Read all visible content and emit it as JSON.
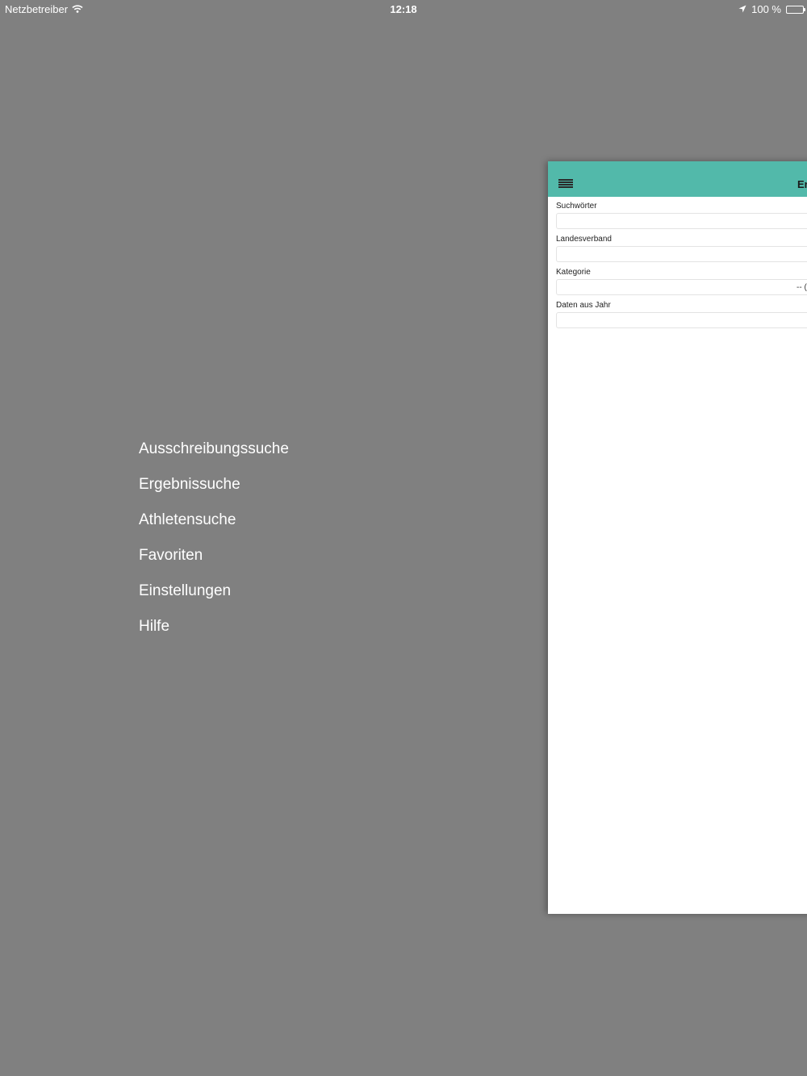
{
  "status_bar": {
    "carrier": "Netzbetreiber",
    "wifi_icon": "wifi-icon",
    "time": "12:18",
    "location_icon": "location-arrow-icon",
    "battery_text": "100 %",
    "battery_level": 1.0
  },
  "side_menu": {
    "items": [
      {
        "label": "Ausschreibungssuche"
      },
      {
        "label": "Ergebnissuche"
      },
      {
        "label": "Athletensuche"
      },
      {
        "label": "Favoriten"
      },
      {
        "label": "Einstellungen"
      },
      {
        "label": "Hilfe"
      }
    ]
  },
  "panel": {
    "header_color": "#52b9aa",
    "menu_icon": "hamburger-menu-icon",
    "title": "Er",
    "form": {
      "search_words_label": "Suchwörter",
      "search_words_value": "",
      "state_association_label": "Landesverband",
      "state_association_value": "",
      "category_label": "Kategorie",
      "category_value": "-- (",
      "data_year_label": "Daten aus Jahr",
      "data_year_value": ""
    }
  }
}
